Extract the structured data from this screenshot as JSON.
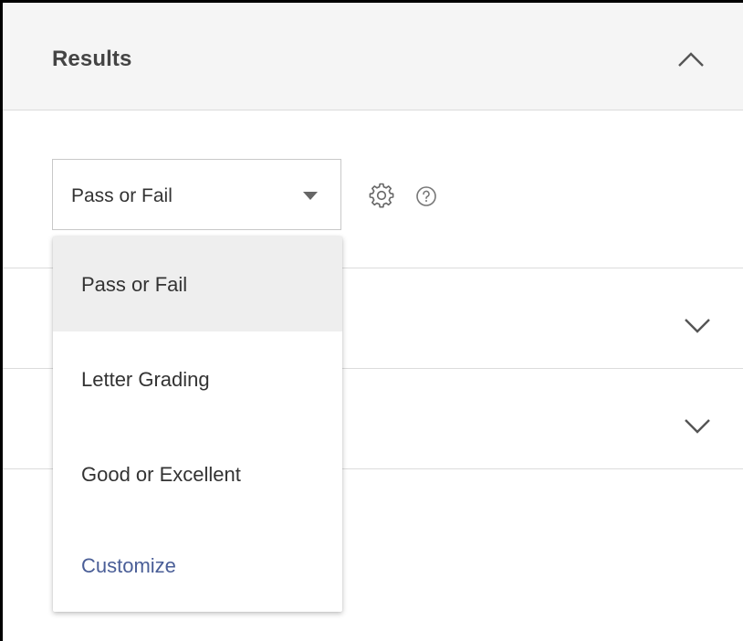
{
  "results_section": {
    "title": "Results",
    "collapse_icon": "chevron-up-icon"
  },
  "grading_select": {
    "selected_value": "Pass or Fail",
    "caret_icon": "caret-down-icon",
    "settings_icon": "gear-icon",
    "help_icon": "question-circle-icon"
  },
  "dropdown": {
    "options": [
      {
        "label": "Pass or Fail",
        "selected": true
      },
      {
        "label": "Letter Grading",
        "selected": false
      },
      {
        "label": "Good or Excellent",
        "selected": false
      },
      {
        "label": "Customize",
        "selected": false
      }
    ]
  },
  "collapsed_rows": [
    {
      "expand_icon": "chevron-down-icon"
    },
    {
      "expand_icon": "chevron-down-icon"
    }
  ],
  "colors": {
    "header_bg": "#f5f5f5",
    "divider": "#dcdcdc",
    "selected_option_bg": "#eeeeee",
    "customize_link": "#4a5e97",
    "text": "#333333"
  }
}
